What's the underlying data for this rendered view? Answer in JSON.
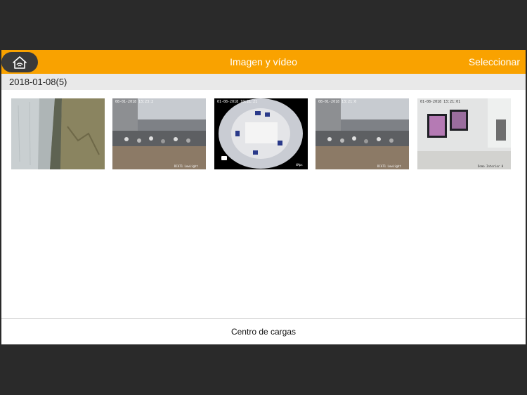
{
  "header": {
    "title": "Imagen y vídeo",
    "select_label": "Seleccionar",
    "home_icon": "home-wifi-icon",
    "accent_color": "#f9a200"
  },
  "gallery": {
    "date_group": "2018-01-08(5)",
    "thumbnails": [
      {
        "kind": "wall-grass"
      },
      {
        "kind": "parking-lot"
      },
      {
        "kind": "fisheye-room"
      },
      {
        "kind": "parking-lot"
      },
      {
        "kind": "monitor-room"
      }
    ]
  },
  "footer": {
    "upload_center_label": "Centro de cargas"
  }
}
